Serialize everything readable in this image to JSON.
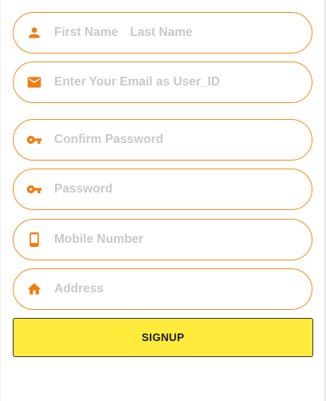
{
  "form": {
    "name": {
      "first_placeholder": "First Name",
      "last_placeholder": "Last Name",
      "icon": "person-icon"
    },
    "email": {
      "placeholder": "Enter Your Email as User_ID",
      "icon": "mail-icon"
    },
    "confirm_password": {
      "placeholder": "Confirm Password",
      "icon": "key-icon"
    },
    "password": {
      "placeholder": "Password",
      "icon": "key-icon"
    },
    "mobile": {
      "placeholder": "Mobile Number",
      "icon": "phone-icon"
    },
    "address": {
      "placeholder": "Address",
      "icon": "home-icon"
    },
    "signup_label": "SIGNUP"
  },
  "colors": {
    "accent": "#f28c1e",
    "icon": "#f07c12",
    "placeholder": "#c9c9c9",
    "button": "#ffeb3b"
  }
}
